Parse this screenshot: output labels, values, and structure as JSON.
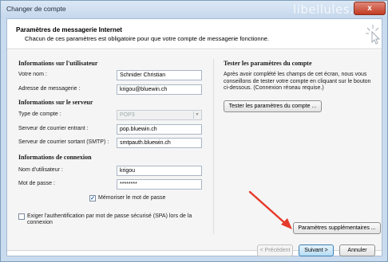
{
  "window": {
    "title": "Changer de compte",
    "watermark": "libellules.ch",
    "close_label": "x"
  },
  "header": {
    "title": "Paramètres de messagerie Internet",
    "subtitle": "Chacun de ces paramètres est obligatoire pour que votre compte de messagerie fonctionne."
  },
  "user_info": {
    "title": "Informations sur l'utilisateur",
    "name_label": "Votre nom :",
    "name_value": "Schnider Christian",
    "email_label": "Adresse de messagerie :",
    "email_value": "krigou@bluewin.ch"
  },
  "server_info": {
    "title": "Informations sur le serveur",
    "type_label": "Type de compte :",
    "type_value": "POP3",
    "incoming_label": "Serveur de courrier entrant :",
    "incoming_value": "pop.bluewin.ch",
    "outgoing_label": "Serveur de courrier sortant (SMTP) :",
    "outgoing_value": "smtpauth.bluewin.ch"
  },
  "login_info": {
    "title": "Informations de connexion",
    "username_label": "Nom d'utilisateur :",
    "username_value": "krigou",
    "password_label": "Mot de passe :",
    "password_value": "********",
    "remember_label": "Mémoriser le mot de passe",
    "remember_checked": true,
    "spa_label": "Exiger l'authentification par mot de passe sécurisé (SPA) lors de la connexion",
    "spa_checked": false
  },
  "test_panel": {
    "title": "Tester les paramètres du compte",
    "description": "Après avoir complété les champs de cet écran, nous vous conseillons de tester votre compte en cliquant sur le bouton ci-dessous. (Connexion réseau requise.)",
    "test_button": "Tester les paramètres du compte ..."
  },
  "more_settings_button": "Paramètres supplémentaires ...",
  "footer": {
    "back_button": "< Précédent",
    "next_button": "Suivant >",
    "cancel_button": "Annuler"
  },
  "colors": {
    "arrow": "#e53a2a",
    "accent": "#3c7fb1"
  }
}
